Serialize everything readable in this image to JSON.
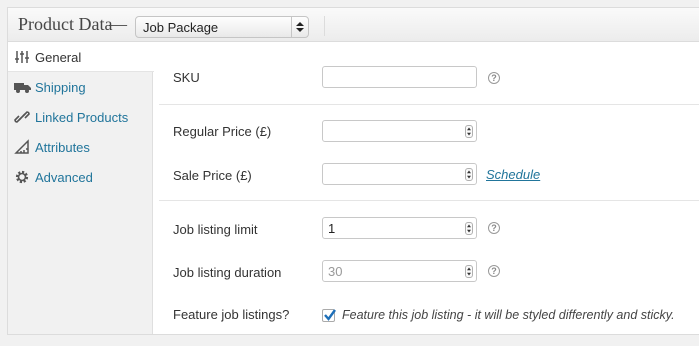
{
  "header": {
    "title": "Product Data",
    "dash": "—",
    "product_type": "Job Package"
  },
  "sidebar": {
    "tabs": [
      {
        "label": "General",
        "icon": "sliders-icon",
        "active": true
      },
      {
        "label": "Shipping",
        "icon": "truck-icon"
      },
      {
        "label": "Linked Products",
        "icon": "link-icon"
      },
      {
        "label": "Attributes",
        "icon": "ruler-icon"
      },
      {
        "label": "Advanced",
        "icon": "gear-icon"
      }
    ]
  },
  "fields": {
    "sku": {
      "label": "SKU",
      "value": ""
    },
    "regular_price": {
      "label": "Regular Price (£)",
      "value": ""
    },
    "sale_price": {
      "label": "Sale Price (£)",
      "value": "",
      "link": "Schedule"
    },
    "job_listing_limit": {
      "label": "Job listing limit",
      "value": "1"
    },
    "job_listing_duration": {
      "label": "Job listing duration",
      "placeholder": "30"
    },
    "feature_job_listings": {
      "label": "Feature job listings?",
      "checked": true,
      "description": "Feature this job listing - it will be styled differently and sticky."
    }
  },
  "colors": {
    "link": "#21759b",
    "check": "#1e6fb8"
  }
}
